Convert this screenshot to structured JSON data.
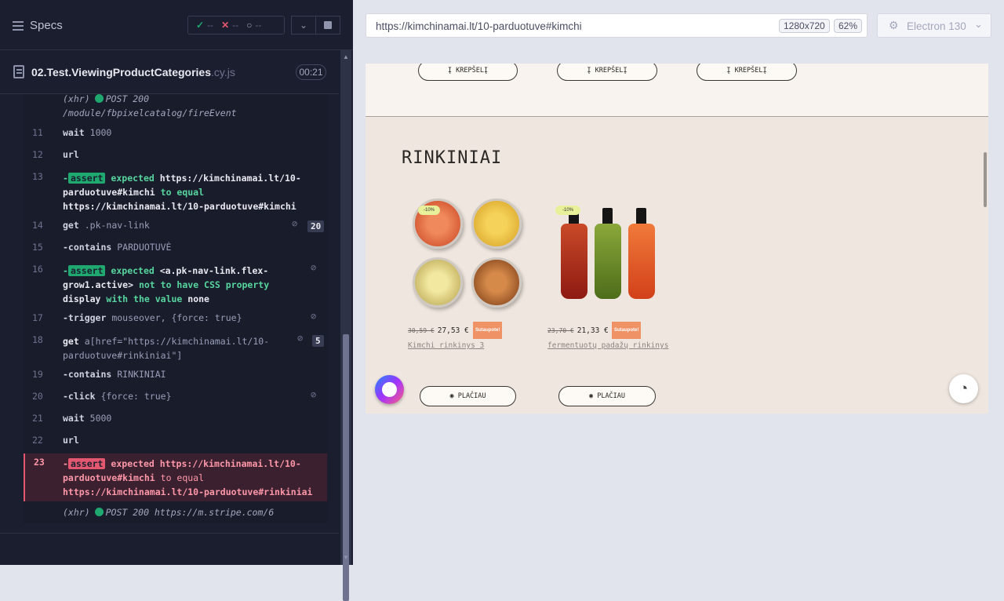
{
  "reporter": {
    "specs_label": "Specs",
    "stats": {
      "passed": "--",
      "failed": "--",
      "pending": "--"
    },
    "file": {
      "name": "02.Test.ViewingProductCategories",
      "ext": ".cy.js",
      "duration": "00:21"
    }
  },
  "log": {
    "xhr1_prefix": "(xhr)",
    "xhr1_req": "POST 200",
    "xhr1_path": "/module/fbpixelcatalog/fireEvent",
    "rows": [
      {
        "n": "11",
        "cmd": "wait",
        "arg": "1000"
      },
      {
        "n": "12",
        "cmd": "url",
        "arg": ""
      },
      {
        "n": "13",
        "tag": "assert",
        "pre": "expected",
        "v1": "https://kimchinamai.lt/10-",
        "v1b": "parduotuve#kimchi",
        "mid": "to equal",
        "v2": "https://kimchinamai.lt/10-parduotuve#kimchi"
      },
      {
        "n": "14",
        "cmd": "get",
        "arg": ".pk-nav-link",
        "count": "20"
      },
      {
        "n": "15",
        "cmd": "-contains",
        "arg": "PARDUOTUVĖ"
      },
      {
        "n": "16",
        "tag": "assert",
        "pre": "expected",
        "v1": "<a.pk-nav-link.flex-",
        "v1b": "grow1.active>",
        "mid": "not to have CSS property",
        "v2a": "display",
        "mid2": "with the value",
        "v2": "none"
      },
      {
        "n": "17",
        "cmd": "-trigger",
        "arg": "mouseover, {force: true}"
      },
      {
        "n": "18",
        "cmd": "get",
        "arg": "a[href=\"https://kimchinamai.lt/10-",
        "arg2": "parduotuve#rinkiniai\"]",
        "count": "5"
      },
      {
        "n": "19",
        "cmd": "-contains",
        "arg": "RINKINIAI"
      },
      {
        "n": "20",
        "cmd": "-click",
        "arg": "{force: true}"
      },
      {
        "n": "21",
        "cmd": "wait",
        "arg": "5000"
      },
      {
        "n": "22",
        "cmd": "url",
        "arg": ""
      },
      {
        "n": "23",
        "tag": "assert",
        "pre": "expected",
        "v1": "https://kimchinamai.lt/10-",
        "v1b": "parduotuve#kimchi",
        "mid": "to equal",
        "v2": "https://kimchinamai.lt/10-parduotuve#rinkiniai"
      }
    ],
    "xhr2_prefix": "(xhr)",
    "xhr2_req": "POST 200 https://m.stripe.com/6"
  },
  "browser": {
    "url": "https://kimchinamai.lt/10-parduotuve#kimchi",
    "viewport": "1280x720",
    "scale": "62%",
    "engine": "Electron 130"
  },
  "page": {
    "cart_button": "Į KREPŠELĮ",
    "section_title": "RINKINIAI",
    "discount": "-10%",
    "more_button": "PLAČIAU",
    "products": [
      {
        "old_price": "30,59 €",
        "price": "27,53 €",
        "badge": "Sutaupote!",
        "name": "Kimchi rinkinys 3"
      },
      {
        "old_price": "23,70 €",
        "price": "21,33 €",
        "badge": "Sutaupote!",
        "name": "fermentuotų padažų rinkinys"
      }
    ]
  },
  "colors": {
    "pass": "#1fa971",
    "fail": "#e45770",
    "sale": "#ef9266"
  }
}
